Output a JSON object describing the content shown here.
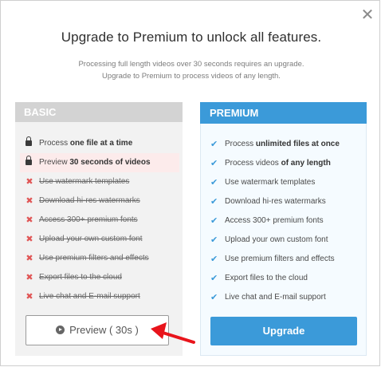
{
  "dialog": {
    "title": "Upgrade to Premium to unlock all features.",
    "subtitle_line1": "Processing full length videos over 30 seconds requires an upgrade.",
    "subtitle_line2": "Upgrade to Premium to process videos of any length.",
    "close_label": "✕"
  },
  "basic": {
    "title": "BASIC",
    "items": [
      {
        "pre": "Process ",
        "bold": "one file at a time",
        "post": ""
      },
      {
        "pre": "Preview ",
        "bold": "30 seconds of videos",
        "post": ""
      },
      {
        "text": "Use watermark templates"
      },
      {
        "text": "Download hi-res watermarks"
      },
      {
        "text": "Access 300+ premium fonts"
      },
      {
        "text": "Upload your own custom font"
      },
      {
        "text": "Use premium filters and effects"
      },
      {
        "text": "Export files to the cloud"
      },
      {
        "text": "Live chat and E-mail support"
      }
    ],
    "button_label": "Preview ( 30s )"
  },
  "premium": {
    "title": "PREMIUM",
    "items": [
      {
        "pre": "Process ",
        "bold": "unlimited files at once",
        "post": ""
      },
      {
        "pre": "Process videos ",
        "bold": "of any length",
        "post": ""
      },
      {
        "text": "Use watermark templates"
      },
      {
        "text": "Download hi-res watermarks"
      },
      {
        "text": "Access 300+ premium fonts"
      },
      {
        "text": "Upload your own custom font"
      },
      {
        "text": "Use premium filters and effects"
      },
      {
        "text": "Export files to the cloud"
      },
      {
        "text": "Live chat and E-mail support"
      }
    ],
    "button_label": "Upgrade"
  },
  "colors": {
    "accent": "#3b9ad9",
    "disabled_x": "#e05555",
    "annotation_arrow": "#e8141b"
  }
}
